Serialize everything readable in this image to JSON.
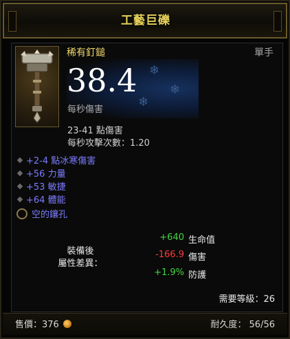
{
  "title": "工藝巨礫",
  "item": {
    "type": "稀有釘鎚",
    "slot": "單手",
    "icon": "mace-icon",
    "dps_value": "38.4",
    "dps_label": "每秒傷害",
    "damage_range": "23-41 點傷害",
    "attack_speed": "每秒攻擊次數：1.20"
  },
  "affixes": [
    "+2-4 點冰寒傷害",
    "+56 力量",
    "+53 敏捷",
    "+64 體能"
  ],
  "socket_label": "空的鑲孔",
  "compare": {
    "label_line1": "裝備後",
    "label_line2": "屬性差異：",
    "rows": [
      {
        "value": "+640",
        "name": "生命值",
        "color": "#42d642"
      },
      {
        "value": "-166.9",
        "name": "傷害",
        "color": "#ff3b3b"
      },
      {
        "value": "+1.9%",
        "name": "防護",
        "color": "#42d642"
      }
    ]
  },
  "required_level": "需要等級：26",
  "footer": {
    "sell": "售價：376",
    "durability": "耐久度：  56/56"
  },
  "colors": {
    "title_gold": "#e6d25a",
    "affix_blue": "#7b7bff",
    "item_type": "#f3d96a"
  }
}
